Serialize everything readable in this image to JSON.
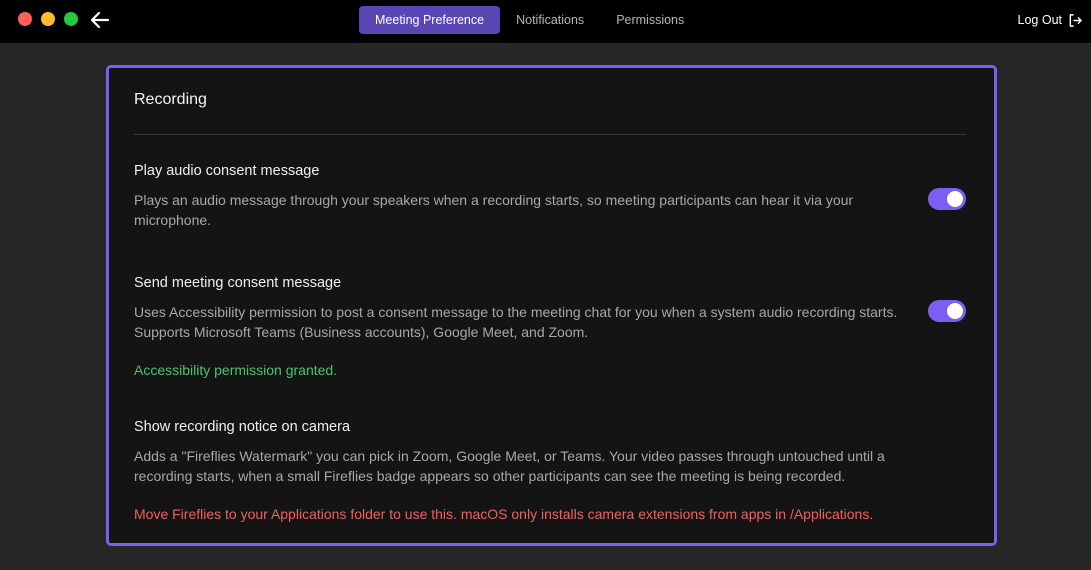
{
  "window": {
    "controls": [
      "close",
      "minimize",
      "zoom"
    ]
  },
  "header": {
    "tabs": [
      {
        "label": "Meeting Preference",
        "active": true
      },
      {
        "label": "Notifications",
        "active": false
      },
      {
        "label": "Permissions",
        "active": false
      }
    ],
    "logout_label": "Log Out"
  },
  "panel": {
    "title": "Recording",
    "settings": [
      {
        "title": "Play audio consent message",
        "description": "Plays an audio message through your speakers when a recording starts, so meeting participants can hear it via your microphone.",
        "enabled": true
      },
      {
        "title": "Send meeting consent message",
        "description": "Uses Accessibility permission to post a consent message to the meeting chat for you when a system audio recording starts. Supports Microsoft Teams (Business accounts), Google Meet, and Zoom.",
        "enabled": true,
        "status": "Accessibility permission granted."
      },
      {
        "title": "Show recording notice on camera",
        "description": "Adds a \"Fireflies Watermark\" you can pick in Zoom, Google Meet, or Teams. Your video passes through untouched until a recording starts, when a small Fireflies badge appears so other participants can see the meeting is being recorded.",
        "warning": "Move Fireflies to your Applications folder to use this. macOS only installs camera extensions from apps in /Applications."
      }
    ]
  },
  "colors": {
    "accent": "#7b5ff0",
    "tab_active": "#5a45b5",
    "success": "#4cc36e",
    "warning": "#f06060"
  }
}
